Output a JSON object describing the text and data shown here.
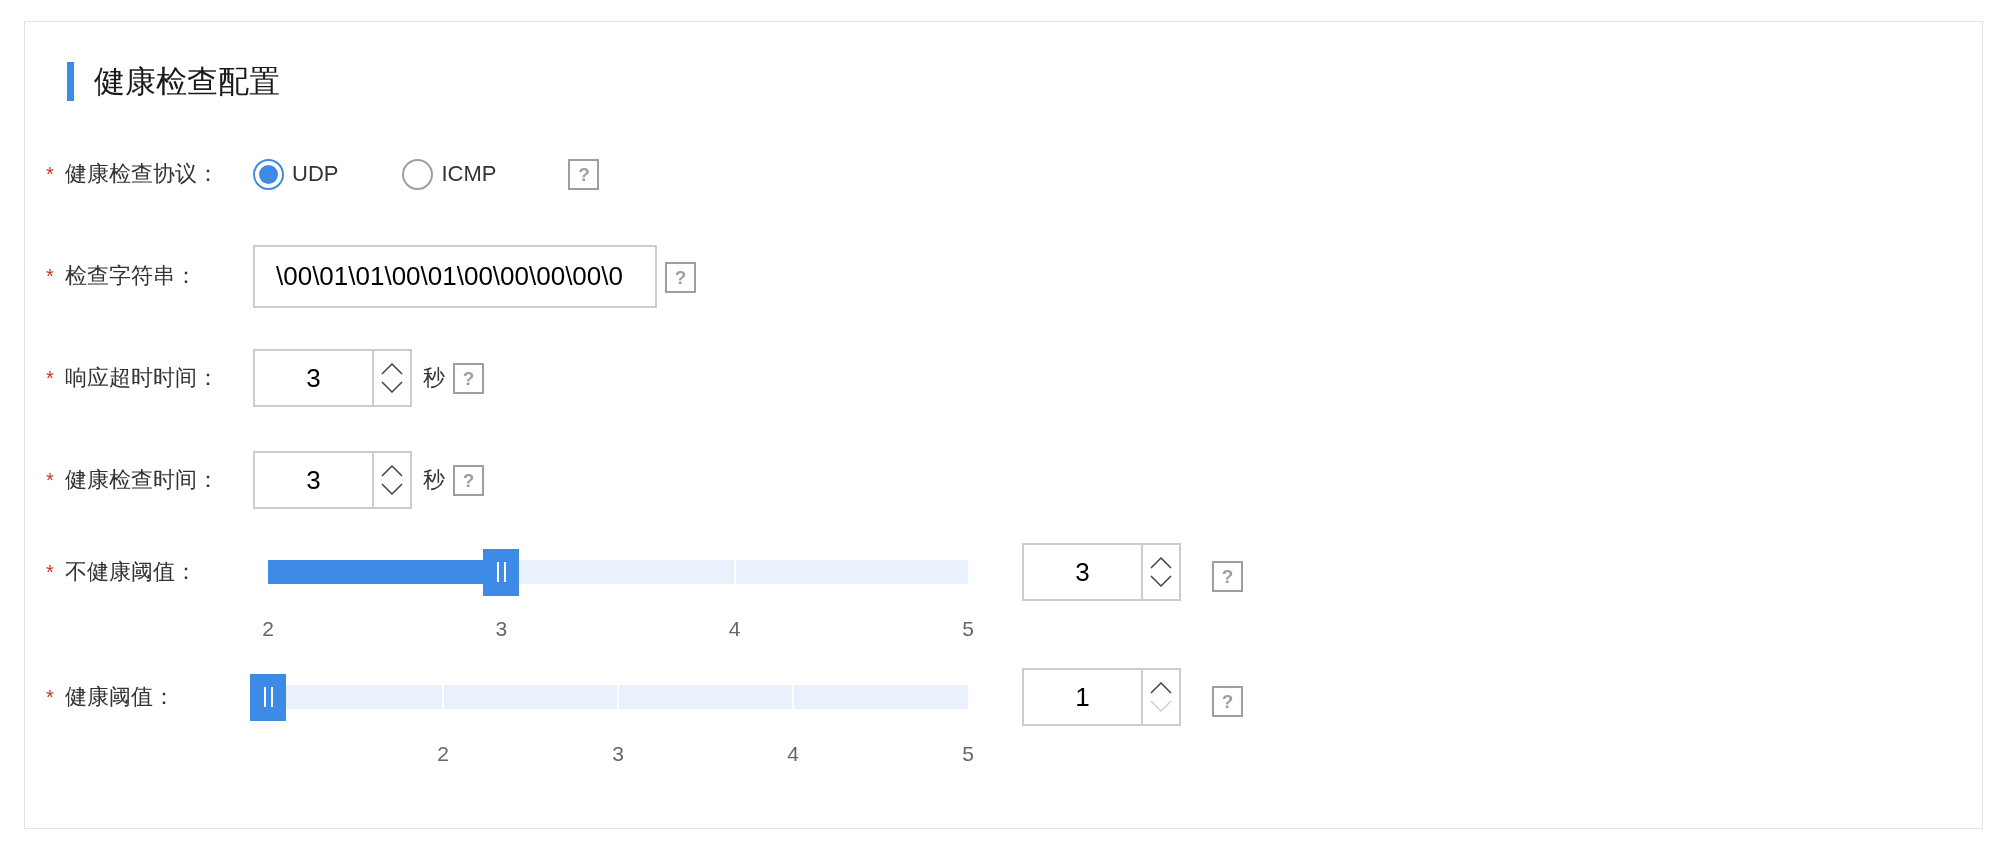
{
  "section": {
    "title": "健康检查配置"
  },
  "fields": [
    {
      "kind": "radio",
      "mark": "*",
      "label": "健康检查协议：",
      "options": [
        {
          "label": "UDP",
          "selected": true
        },
        {
          "label": "ICMP",
          "selected": false
        }
      ],
      "help": "?"
    },
    {
      "kind": "text",
      "mark": "*",
      "label": "检查字符串：",
      "value": "\\00\\01\\01\\00\\01\\00\\00\\00\\00\\0",
      "help": "?"
    },
    {
      "kind": "number",
      "mark": "*",
      "label": "响应超时时间：",
      "value": "3",
      "down_disabled": false,
      "unit": "秒",
      "help": "?"
    },
    {
      "kind": "number",
      "mark": "*",
      "label": "健康检查时间：",
      "value": "3",
      "down_disabled": false,
      "unit": "秒",
      "help": "?"
    },
    {
      "kind": "slider",
      "mark": "*",
      "label": "不健康阈值：",
      "level": 0.3333,
      "marks": [
        {
          "kind": "labeled",
          "label": "2"
        },
        {
          "kind": "labeled",
          "label": "3"
        },
        {
          "kind": "labeled",
          "label": "4"
        },
        {
          "kind": "labeled",
          "label": "5"
        }
      ],
      "value": "3",
      "down_disabled": false,
      "help": "?"
    },
    {
      "kind": "slider",
      "mark": "*",
      "label": "健康阈值：",
      "level": 0,
      "marks": [
        {
          "kind": "blank"
        },
        {
          "kind": "labeled",
          "label": "2"
        },
        {
          "kind": "labeled",
          "label": "3"
        },
        {
          "kind": "labeled",
          "label": "4"
        },
        {
          "kind": "labeled",
          "label": "5"
        }
      ],
      "value": "1",
      "down_disabled": true,
      "help": "?"
    }
  ]
}
